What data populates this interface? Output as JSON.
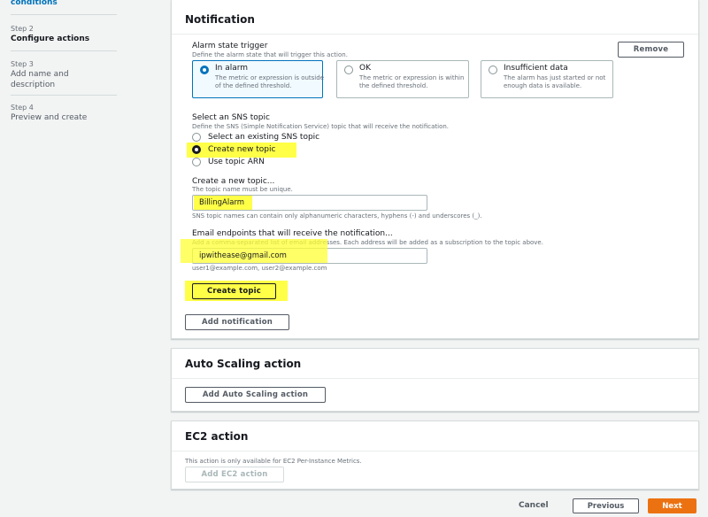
{
  "sidebar": {
    "prev_step_label": "conditions",
    "steps": [
      {
        "num": "Step 2",
        "label": "Configure actions"
      },
      {
        "num": "Step 3",
        "label": "Add name and description"
      },
      {
        "num": "Step 4",
        "label": "Preview and create"
      }
    ]
  },
  "notification": {
    "title": "Notification",
    "remove_label": "Remove",
    "alarm_trigger": {
      "label": "Alarm state trigger",
      "desc": "Define the alarm state that will trigger this action.",
      "options": [
        {
          "title": "In alarm",
          "desc": "The metric or expression is outside of the defined threshold.",
          "selected": true
        },
        {
          "title": "OK",
          "desc": "The metric or expression is within the defined threshold.",
          "selected": false
        },
        {
          "title": "Insufficient data",
          "desc": "The alarm has just started or not enough data is available.",
          "selected": false
        }
      ]
    },
    "sns": {
      "label": "Select an SNS topic",
      "desc": "Define the SNS (Simple Notification Service) topic that will receive the notification.",
      "options": [
        "Select an existing SNS topic",
        "Create new topic",
        "Use topic ARN"
      ],
      "selected": "Create new topic"
    },
    "new_topic": {
      "label": "Create a new topic...",
      "desc": "The topic name must be unique.",
      "value": "BillingAlarm",
      "hint": "SNS topic names can contain only alphanumeric characters, hyphens (-) and underscores (_)."
    },
    "email": {
      "label": "Email endpoints that will receive the notification...",
      "desc": "Add a comma-separated list of email addresses. Each address will be added as a subscription to the topic above.",
      "value": "ipwithease@gmail.com",
      "hint": "user1@example.com, user2@example.com"
    },
    "create_topic_label": "Create topic",
    "add_notification_label": "Add notification"
  },
  "autoscaling": {
    "title": "Auto Scaling action",
    "add_label": "Add Auto Scaling action"
  },
  "ec2": {
    "title": "EC2 action",
    "desc": "This action is only available for EC2 Per-Instance Metrics.",
    "add_label": "Add EC2 action"
  },
  "footer": {
    "cancel_label": "Cancel",
    "previous_label": "Previous",
    "next_label": "Next"
  },
  "colors": {
    "accent": "#0073bb",
    "primary_button": "#ec7211",
    "highlight": "#ffff33"
  }
}
